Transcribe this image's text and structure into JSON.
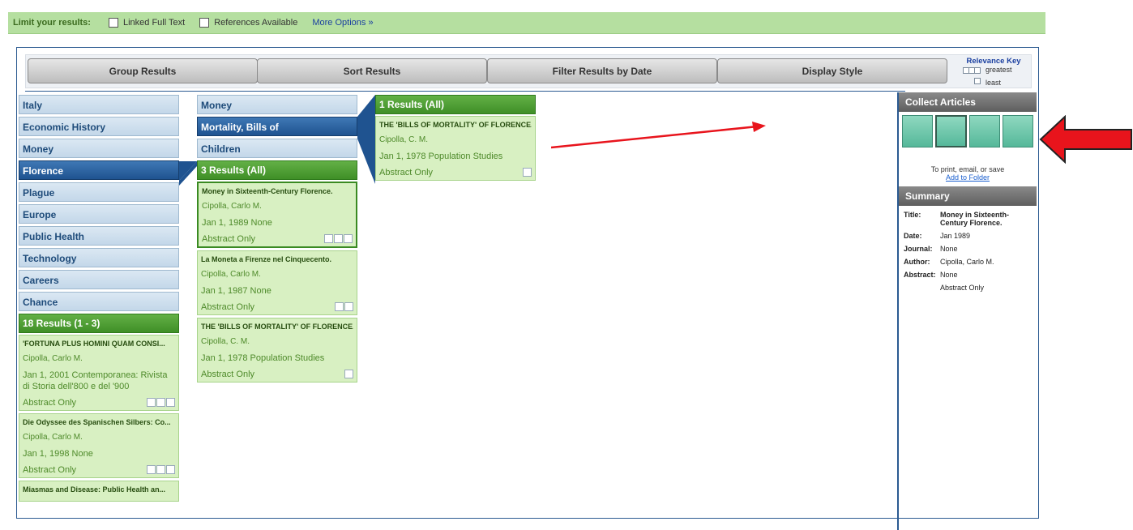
{
  "limit": {
    "label": "Limit your results:",
    "options": [
      "Linked Full Text",
      "References Available"
    ],
    "more": "More Options »"
  },
  "toolbar": {
    "buttons": [
      "Group Results",
      "Sort Results",
      "Filter Results by Date",
      "Display Style"
    ],
    "relevance_key": {
      "title": "Relevance Key",
      "greatest": "greatest",
      "least": "least"
    }
  },
  "col1": {
    "categories": [
      "Italy",
      "Economic History",
      "Money",
      "Florence",
      "Plague",
      "Europe",
      "Public Health",
      "Technology",
      "Careers",
      "Chance"
    ],
    "selected": "Florence",
    "results_header": "18 Results (1 - 3)",
    "results": [
      {
        "title": "'FORTUNA PLUS HOMINI QUAM CONSI...",
        "author": "Cipolla, Carlo M.",
        "pub": "Jan 1, 2001 Contemporanea: Rivista di Storia dell'800 e del '900",
        "abs": "Abstract Only"
      },
      {
        "title": "Die Odyssee des Spanischen Silbers: Co...",
        "author": "Cipolla, Carlo M.",
        "pub": "Jan 1, 1998 None",
        "abs": "Abstract Only"
      },
      {
        "title": "Miasmas and Disease: Public Health an..."
      }
    ]
  },
  "col2": {
    "categories": [
      "Money",
      "Mortality, Bills of",
      "Children"
    ],
    "selected": "Mortality, Bills of",
    "results_header": "3 Results (All)",
    "results": [
      {
        "title": "Money in Sixteenth-Century Florence.",
        "author": "Cipolla, Carlo M.",
        "pub": "Jan 1, 1989 None",
        "abs": "Abstract Only"
      },
      {
        "title": "La Moneta a Firenze nel Cinquecento.",
        "author": "Cipolla, Carlo M.",
        "pub": "Jan 1, 1987 None",
        "abs": "Abstract Only"
      },
      {
        "title": "THE 'BILLS OF MORTALITY' OF FLORENCE.",
        "author": "Cipolla, C. M.",
        "pub": "Jan 1, 1978 Population Studies",
        "abs": "Abstract Only"
      }
    ]
  },
  "col3": {
    "results_header": "1 Results (All)",
    "results": [
      {
        "title": "THE 'BILLS OF MORTALITY' OF FLORENCE.",
        "author": "Cipolla, C. M.",
        "pub": "Jan 1, 1978 Population Studies",
        "abs": "Abstract Only"
      }
    ]
  },
  "collect": {
    "title": "Collect Articles",
    "note": "To print, email, or save",
    "link": "Add to Folder"
  },
  "summary": {
    "title": "Summary",
    "fields": [
      {
        "k": "Title:",
        "v": "Money in Sixteenth-Century Florence."
      },
      {
        "k": "Date:",
        "v": "Jan 1989"
      },
      {
        "k": "Journal:",
        "v": "None"
      },
      {
        "k": "Author:",
        "v": "Cipolla, Carlo M."
      },
      {
        "k": "Abstract:",
        "v": "None"
      },
      {
        "k": "",
        "v": "Abstract Only"
      }
    ]
  }
}
